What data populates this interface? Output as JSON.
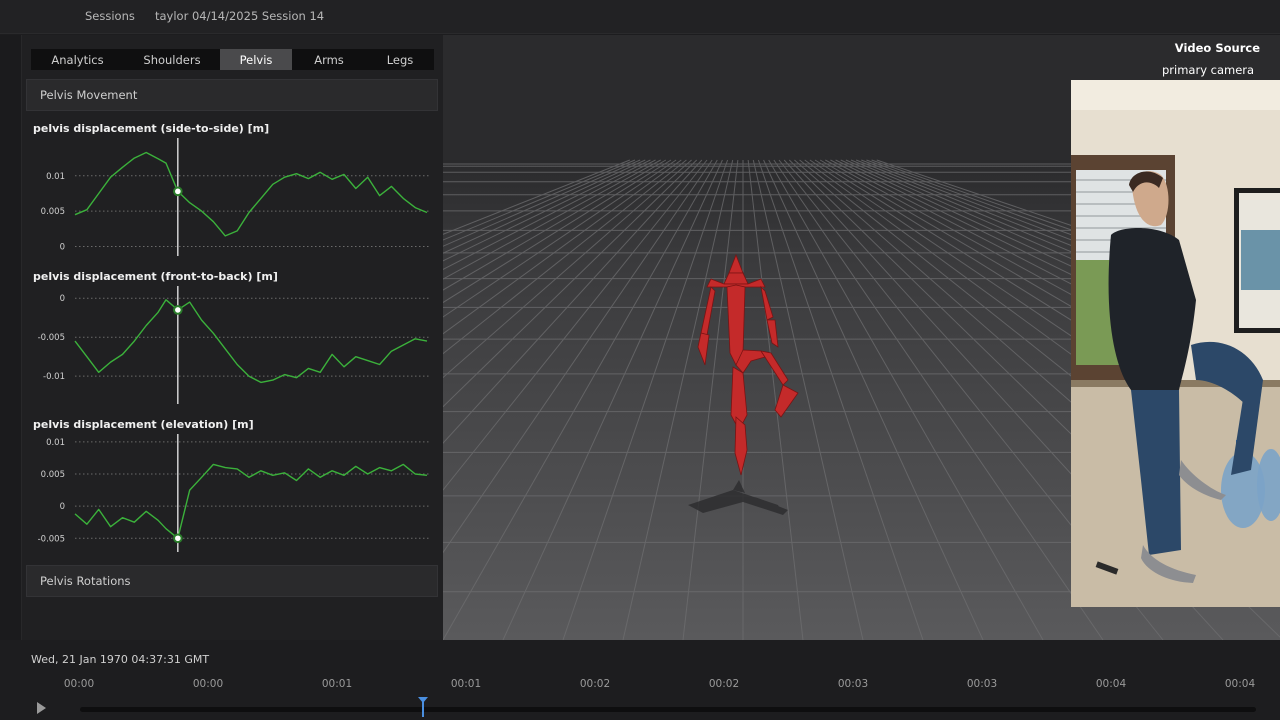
{
  "breadcrumb": {
    "sessions": "Sessions",
    "session": "taylor 04/14/2025 Session 14"
  },
  "tabs": [
    {
      "label": "Analytics",
      "active": false
    },
    {
      "label": "Shoulders",
      "active": false
    },
    {
      "label": "Pelvis",
      "active": true
    },
    {
      "label": "Arms",
      "active": false
    },
    {
      "label": "Legs",
      "active": false
    }
  ],
  "sections": {
    "movement": "Pelvis Movement",
    "rotations": "Pelvis Rotations"
  },
  "colors": {
    "series": "#3bb13b",
    "cursor": "#ffffff",
    "skeleton": "#c42a2a",
    "accent": "#4a8fe0"
  },
  "chart_data": [
    {
      "type": "line",
      "title": "pelvis displacement (side-to-side) [m]",
      "xlabel": "",
      "ylabel": "",
      "yticks": [
        "0.01",
        "0.005",
        "0"
      ],
      "ylim": [
        -0.0005,
        0.0145
      ],
      "xlim": [
        0,
        4.5
      ],
      "cursor_x": 1.3,
      "series": [
        {
          "x": [
            0,
            0.15,
            0.3,
            0.45,
            0.6,
            0.75,
            0.9,
            1.05,
            1.15,
            1.3,
            1.45,
            1.6,
            1.75,
            1.9,
            2.05,
            2.2,
            2.35,
            2.5,
            2.65,
            2.8,
            2.95,
            3.1,
            3.25,
            3.4,
            3.55,
            3.7,
            3.85,
            4.0,
            4.15,
            4.3,
            4.45
          ],
          "values": [
            0.0045,
            0.0052,
            0.0075,
            0.0098,
            0.0112,
            0.0125,
            0.0133,
            0.0124,
            0.0118,
            0.0078,
            0.0062,
            0.005,
            0.0035,
            0.0015,
            0.0022,
            0.0048,
            0.0068,
            0.0088,
            0.0098,
            0.0103,
            0.0096,
            0.0105,
            0.0095,
            0.0102,
            0.0082,
            0.0098,
            0.0072,
            0.0085,
            0.0068,
            0.0055,
            0.0048
          ]
        }
      ]
    },
    {
      "type": "line",
      "title": "pelvis displacement (front-to-back) [m]",
      "xlabel": "",
      "ylabel": "",
      "yticks": [
        "0",
        "-0.005",
        "-0.01"
      ],
      "ylim": [
        -0.0128,
        0.0008
      ],
      "xlim": [
        0,
        4.5
      ],
      "cursor_x": 1.3,
      "series": [
        {
          "x": [
            0,
            0.15,
            0.3,
            0.45,
            0.6,
            0.75,
            0.9,
            1.05,
            1.15,
            1.3,
            1.45,
            1.6,
            1.75,
            1.9,
            2.05,
            2.2,
            2.35,
            2.5,
            2.65,
            2.8,
            2.95,
            3.1,
            3.25,
            3.4,
            3.55,
            3.7,
            3.85,
            4.0,
            4.15,
            4.3,
            4.45
          ],
          "values": [
            -0.0055,
            -0.0075,
            -0.0095,
            -0.0082,
            -0.0072,
            -0.0055,
            -0.0035,
            -0.0018,
            -0.0002,
            -0.0015,
            -0.0005,
            -0.0028,
            -0.0045,
            -0.0065,
            -0.0085,
            -0.01,
            -0.0108,
            -0.0105,
            -0.0098,
            -0.0102,
            -0.009,
            -0.0095,
            -0.0072,
            -0.0088,
            -0.0075,
            -0.008,
            -0.0085,
            -0.0068,
            -0.006,
            -0.0052,
            -0.0055
          ]
        }
      ]
    },
    {
      "type": "line",
      "title": "pelvis displacement (elevation) [m]",
      "xlabel": "",
      "ylabel": "",
      "yticks": [
        "0.01",
        "0.005",
        "0",
        "-0.005"
      ],
      "ylim": [
        -0.0062,
        0.0103
      ],
      "xlim": [
        0,
        4.5
      ],
      "cursor_x": 1.3,
      "series": [
        {
          "x": [
            0,
            0.15,
            0.3,
            0.45,
            0.6,
            0.75,
            0.9,
            1.05,
            1.15,
            1.3,
            1.45,
            1.6,
            1.75,
            1.9,
            2.05,
            2.2,
            2.35,
            2.5,
            2.65,
            2.8,
            2.95,
            3.1,
            3.25,
            3.4,
            3.55,
            3.7,
            3.85,
            4.0,
            4.15,
            4.3,
            4.45
          ],
          "values": [
            -0.0012,
            -0.0028,
            -0.0005,
            -0.0032,
            -0.0018,
            -0.0025,
            -0.0008,
            -0.0022,
            -0.0035,
            -0.005,
            0.0025,
            0.0045,
            0.0065,
            0.006,
            0.0058,
            0.0045,
            0.0055,
            0.0048,
            0.0052,
            0.004,
            0.0058,
            0.0045,
            0.0055,
            0.0048,
            0.0062,
            0.005,
            0.006,
            0.0055,
            0.0065,
            0.005,
            0.0048
          ]
        }
      ]
    }
  ],
  "video": {
    "title": "Video Source",
    "subtitle": "primary camera"
  },
  "timeline": {
    "datetime": "Wed, 21 Jan 1970 04:37:31 GMT",
    "labels": [
      "00:00",
      "00:00",
      "00:01",
      "00:01",
      "00:02",
      "00:02",
      "00:03",
      "00:03",
      "00:04",
      "00:04"
    ]
  }
}
